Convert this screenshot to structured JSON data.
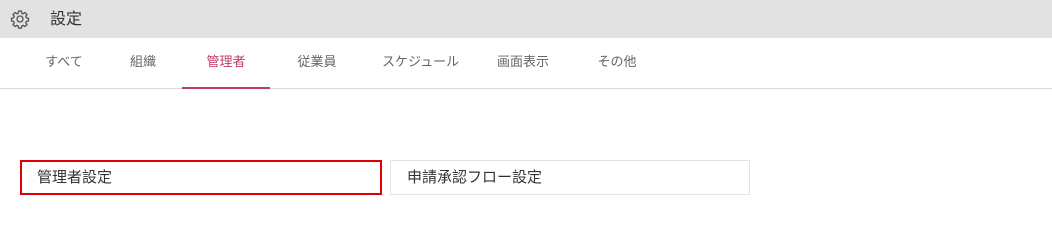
{
  "header": {
    "icon": "gear-icon",
    "title": "設定"
  },
  "tabs": [
    {
      "label": "すべて"
    },
    {
      "label": "組織"
    },
    {
      "label": "管理者",
      "active": true
    },
    {
      "label": "従業員"
    },
    {
      "label": "スケジュール"
    },
    {
      "label": "画面表示"
    },
    {
      "label": "その他"
    }
  ],
  "settings": {
    "admin_settings": "管理者設定",
    "approval_flow_settings": "申請承認フロー設定"
  },
  "colors": {
    "accent": "#c0396b",
    "highlight_border": "#e00000",
    "header_bg": "#e2e2e2"
  }
}
